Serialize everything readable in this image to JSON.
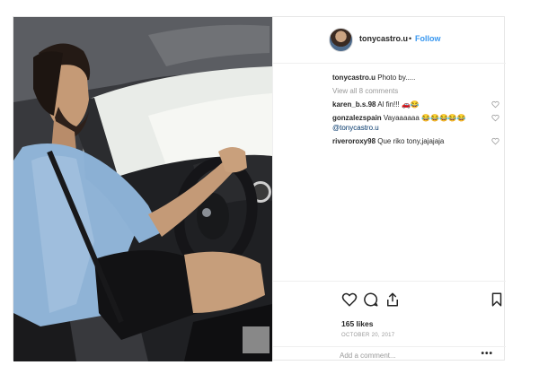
{
  "post": {
    "username": "tonycastro.u",
    "separator": "•",
    "follow_label": "Follow",
    "caption": {
      "username": "tonycastro.u",
      "text": " Photo by....."
    },
    "view_all_comments": "View all 8 comments",
    "comments": [
      {
        "username": "karen_b.s.98",
        "text": " Al fin!!! ",
        "emoji": "🚗😂"
      },
      {
        "username": "gonzalezspain",
        "text": " Vayaaaaaa ",
        "emoji": "😂😂😂😂😂",
        "mention": "@tonycastro.u"
      },
      {
        "username": "riveroroxy98",
        "text": " Que riko tony,jajajaja"
      }
    ],
    "likes": "165 likes",
    "date": "OCTOBER 20, 2017",
    "add_comment_placeholder": "Add a comment...",
    "more_options": "•••"
  },
  "icons": {
    "like": "heart-icon",
    "comment": "comment-icon",
    "share": "share-icon",
    "save": "bookmark-icon",
    "comment_like": "heart-icon"
  },
  "colors": {
    "link_blue": "#3897f0",
    "muted_gray": "#999999",
    "text": "#262626",
    "border": "#efefef"
  }
}
